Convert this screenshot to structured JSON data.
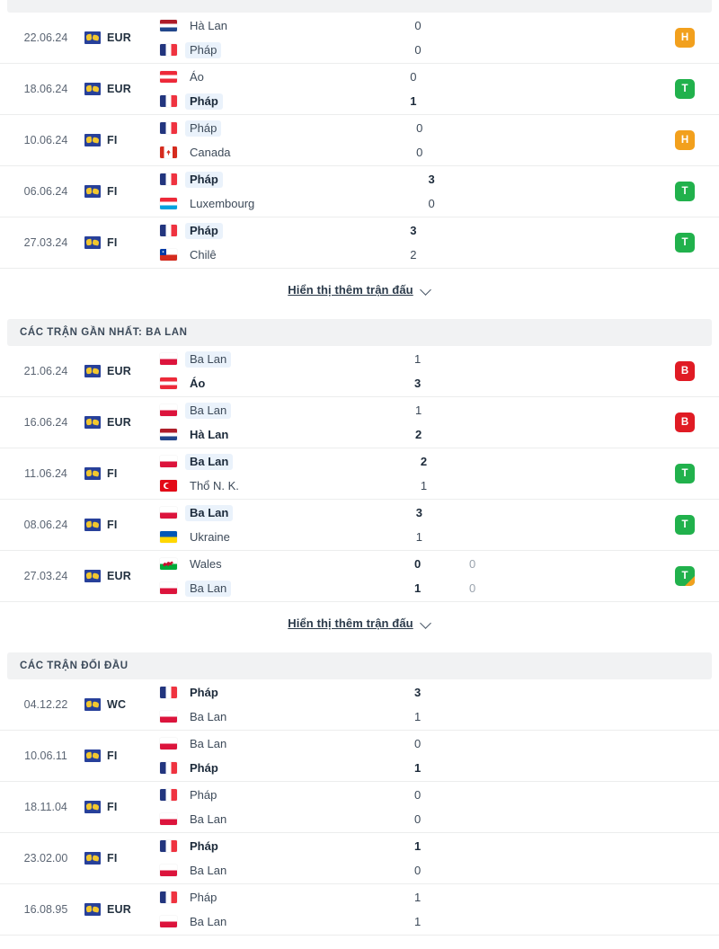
{
  "top_strip": {
    "name": "partial-section-bar"
  },
  "icons": {
    "competition": "world-globe-icon",
    "chevron": "chevron-down-icon"
  },
  "sections": [
    {
      "id": "recent-france",
      "header": null,
      "show_more_label": "Hiển thị thêm trận đấu",
      "matches": [
        {
          "date": "22.06.24",
          "competition": "EUR",
          "home": {
            "name": "Hà Lan",
            "flag": "f-nl",
            "bold": false,
            "highlight": false
          },
          "away": {
            "name": "Pháp",
            "flag": "f-fr",
            "bold": false,
            "highlight": true
          },
          "home_score": "0",
          "away_score": "0",
          "home_score2": "",
          "away_score2": "",
          "home_bold": false,
          "away_bold": false,
          "badge": {
            "letter": "H",
            "type": "draw",
            "corner": false
          }
        },
        {
          "date": "18.06.24",
          "competition": "EUR",
          "home": {
            "name": "Áo",
            "flag": "f-at",
            "bold": false,
            "highlight": false
          },
          "away": {
            "name": "Pháp",
            "flag": "f-fr",
            "bold": true,
            "highlight": true
          },
          "home_score": "0",
          "away_score": "1",
          "home_score2": "",
          "away_score2": "",
          "home_bold": false,
          "away_bold": true,
          "badge": {
            "letter": "T",
            "type": "win",
            "corner": false
          }
        },
        {
          "date": "10.06.24",
          "competition": "FI",
          "home": {
            "name": "Pháp",
            "flag": "f-fr",
            "bold": false,
            "highlight": true
          },
          "away": {
            "name": "Canada",
            "flag": "f-ca",
            "bold": false,
            "highlight": false
          },
          "home_score": "0",
          "away_score": "0",
          "home_score2": "",
          "away_score2": "",
          "home_bold": false,
          "away_bold": false,
          "badge": {
            "letter": "H",
            "type": "draw",
            "corner": false
          }
        },
        {
          "date": "06.06.24",
          "competition": "FI",
          "home": {
            "name": "Pháp",
            "flag": "f-fr",
            "bold": true,
            "highlight": true
          },
          "away": {
            "name": "Luxembourg",
            "flag": "f-lu",
            "bold": false,
            "highlight": false
          },
          "home_score": "3",
          "away_score": "0",
          "home_score2": "",
          "away_score2": "",
          "home_bold": true,
          "away_bold": false,
          "badge": {
            "letter": "T",
            "type": "win",
            "corner": false
          }
        },
        {
          "date": "27.03.24",
          "competition": "FI",
          "home": {
            "name": "Pháp",
            "flag": "f-fr",
            "bold": true,
            "highlight": true
          },
          "away": {
            "name": "Chilê",
            "flag": "f-cl",
            "bold": false,
            "highlight": false
          },
          "home_score": "3",
          "away_score": "2",
          "home_score2": "",
          "away_score2": "",
          "home_bold": true,
          "away_bold": false,
          "badge": {
            "letter": "T",
            "type": "win",
            "corner": false
          }
        }
      ]
    },
    {
      "id": "recent-poland",
      "header": "CÁC TRẬN GẦN NHẤT: BA LAN",
      "show_more_label": "Hiển thị thêm trận đấu",
      "matches": [
        {
          "date": "21.06.24",
          "competition": "EUR",
          "home": {
            "name": "Ba Lan",
            "flag": "f-pl",
            "bold": false,
            "highlight": true
          },
          "away": {
            "name": "Áo",
            "flag": "f-at",
            "bold": true,
            "highlight": false
          },
          "home_score": "1",
          "away_score": "3",
          "home_score2": "",
          "away_score2": "",
          "home_bold": false,
          "away_bold": true,
          "badge": {
            "letter": "B",
            "type": "loss",
            "corner": false
          }
        },
        {
          "date": "16.06.24",
          "competition": "EUR",
          "home": {
            "name": "Ba Lan",
            "flag": "f-pl",
            "bold": false,
            "highlight": true
          },
          "away": {
            "name": "Hà Lan",
            "flag": "f-nl",
            "bold": true,
            "highlight": false
          },
          "home_score": "1",
          "away_score": "2",
          "home_score2": "",
          "away_score2": "",
          "home_bold": false,
          "away_bold": true,
          "badge": {
            "letter": "B",
            "type": "loss",
            "corner": false
          }
        },
        {
          "date": "11.06.24",
          "competition": "FI",
          "home": {
            "name": "Ba Lan",
            "flag": "f-pl",
            "bold": true,
            "highlight": true
          },
          "away": {
            "name": "Thổ N. K.",
            "flag": "f-tr",
            "bold": false,
            "highlight": false
          },
          "home_score": "2",
          "away_score": "1",
          "home_score2": "",
          "away_score2": "",
          "home_bold": true,
          "away_bold": false,
          "badge": {
            "letter": "T",
            "type": "win",
            "corner": false
          }
        },
        {
          "date": "08.06.24",
          "competition": "FI",
          "home": {
            "name": "Ba Lan",
            "flag": "f-pl",
            "bold": true,
            "highlight": true
          },
          "away": {
            "name": "Ukraine",
            "flag": "f-ua",
            "bold": false,
            "highlight": false
          },
          "home_score": "3",
          "away_score": "1",
          "home_score2": "",
          "away_score2": "",
          "home_bold": true,
          "away_bold": false,
          "badge": {
            "letter": "T",
            "type": "win",
            "corner": false
          }
        },
        {
          "date": "27.03.24",
          "competition": "EUR",
          "home": {
            "name": "Wales",
            "flag": "f-wl",
            "bold": false,
            "highlight": false
          },
          "away": {
            "name": "Ba Lan",
            "flag": "f-pl",
            "bold": false,
            "highlight": true
          },
          "home_score": "0",
          "away_score": "1",
          "home_score2": "0",
          "away_score2": "0",
          "home_bold": true,
          "away_bold": true,
          "badge": {
            "letter": "T",
            "type": "win",
            "corner": true
          }
        }
      ]
    },
    {
      "id": "head-to-head",
      "header": "CÁC TRẬN ĐỐI ĐẦU",
      "show_more_label": null,
      "matches": [
        {
          "date": "04.12.22",
          "competition": "WC",
          "home": {
            "name": "Pháp",
            "flag": "f-fr",
            "bold": true,
            "highlight": false
          },
          "away": {
            "name": "Ba Lan",
            "flag": "f-pl",
            "bold": false,
            "highlight": false
          },
          "home_score": "3",
          "away_score": "1",
          "home_score2": "",
          "away_score2": "",
          "home_bold": true,
          "away_bold": false,
          "badge": null
        },
        {
          "date": "10.06.11",
          "competition": "FI",
          "home": {
            "name": "Ba Lan",
            "flag": "f-pl",
            "bold": false,
            "highlight": false
          },
          "away": {
            "name": "Pháp",
            "flag": "f-fr",
            "bold": true,
            "highlight": false
          },
          "home_score": "0",
          "away_score": "1",
          "home_score2": "",
          "away_score2": "",
          "home_bold": false,
          "away_bold": true,
          "badge": null
        },
        {
          "date": "18.11.04",
          "competition": "FI",
          "home": {
            "name": "Pháp",
            "flag": "f-fr",
            "bold": false,
            "highlight": false
          },
          "away": {
            "name": "Ba Lan",
            "flag": "f-pl",
            "bold": false,
            "highlight": false
          },
          "home_score": "0",
          "away_score": "0",
          "home_score2": "",
          "away_score2": "",
          "home_bold": false,
          "away_bold": false,
          "badge": null
        },
        {
          "date": "23.02.00",
          "competition": "FI",
          "home": {
            "name": "Pháp",
            "flag": "f-fr",
            "bold": true,
            "highlight": false
          },
          "away": {
            "name": "Ba Lan",
            "flag": "f-pl",
            "bold": false,
            "highlight": false
          },
          "home_score": "1",
          "away_score": "0",
          "home_score2": "",
          "away_score2": "",
          "home_bold": true,
          "away_bold": false,
          "badge": null
        },
        {
          "date": "16.08.95",
          "competition": "EUR",
          "home": {
            "name": "Pháp",
            "flag": "f-fr",
            "bold": false,
            "highlight": false
          },
          "away": {
            "name": "Ba Lan",
            "flag": "f-pl",
            "bold": false,
            "highlight": false
          },
          "home_score": "1",
          "away_score": "1",
          "home_score2": "",
          "away_score2": "",
          "home_bold": false,
          "away_bold": false,
          "badge": null
        }
      ]
    }
  ]
}
